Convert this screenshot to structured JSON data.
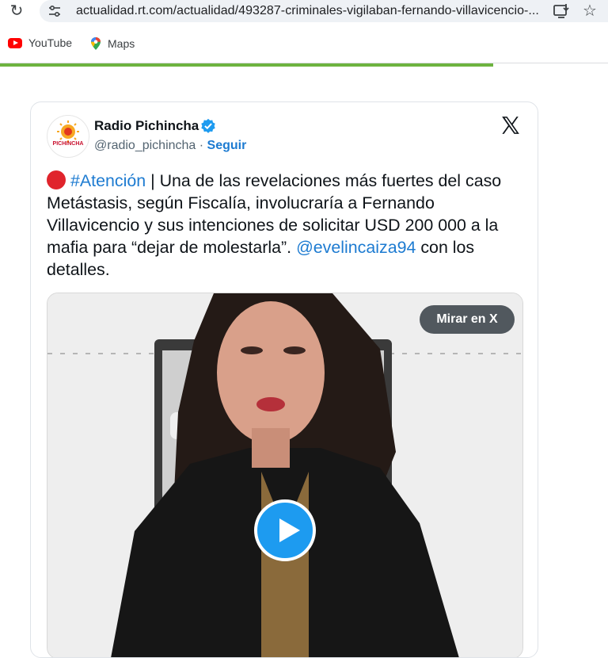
{
  "browser": {
    "url": "actualidad.rt.com/actualidad/493287-criminales-vigilaban-fernando-villavicencio-...",
    "bookmarks": [
      {
        "label": "YouTube",
        "icon": "youtube-icon"
      },
      {
        "label": "Maps",
        "icon": "maps-icon"
      }
    ],
    "page_load_progress_percent": 81
  },
  "tweet": {
    "author_name": "Radio Pichincha",
    "avatar_text": "PICHINCHA",
    "handle": "@radio_pichincha",
    "separator": " · ",
    "follow_label": "Seguir",
    "hashtag": "#Atención",
    "text_main": " | Una de las revelaciones más fuertes del caso Metástasis, según Fiscalía, involucraría a Fernando Villavicencio y sus intenciones de solicitar USD 200 000 a la mafia para “dejar de molestarla”. ",
    "mention": "@evelincaiza94",
    "text_end": " con los detalles.",
    "video_button_label": "Mirar en X"
  },
  "colors": {
    "link_blue": "#1d7bd1",
    "verified_blue": "#1d9bf0",
    "progress_green": "#6db33f",
    "red_dot": "#e0242c"
  }
}
